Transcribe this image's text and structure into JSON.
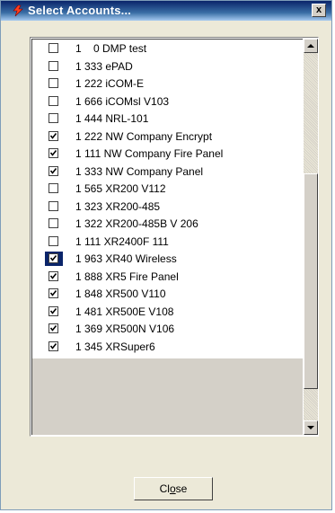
{
  "window": {
    "title": "Select Accounts...",
    "close_glyph": "x"
  },
  "accounts": [
    {
      "label": "1    0 DMP test",
      "checked": false
    },
    {
      "label": "1 333 ePAD",
      "checked": false
    },
    {
      "label": "1 222 iCOM-E",
      "checked": false
    },
    {
      "label": "1 666 iCOMsl V103",
      "checked": false
    },
    {
      "label": "1 444 NRL-101",
      "checked": false
    },
    {
      "label": "1 222 NW Company Encrypt",
      "checked": true
    },
    {
      "label": "1 111 NW Company Fire Panel",
      "checked": true
    },
    {
      "label": "1 333 NW Company Panel",
      "checked": true
    },
    {
      "label": "1 565 XR200 V112",
      "checked": false
    },
    {
      "label": "1 323 XR200-485",
      "checked": false
    },
    {
      "label": "1 322 XR200-485B V 206",
      "checked": false
    },
    {
      "label": "1 111 XR2400F 111",
      "checked": false
    },
    {
      "label": "1 963 XR40 Wireless",
      "checked": true
    },
    {
      "label": "1 888 XR5 Fire Panel",
      "checked": true
    },
    {
      "label": "1 848 XR500 V110",
      "checked": true
    },
    {
      "label": "1 481 XR500E V108",
      "checked": true
    },
    {
      "label": "1 369 XR500N V106",
      "checked": true
    },
    {
      "label": "1 345 XRSuper6",
      "checked": true
    }
  ],
  "focused_index": 12,
  "buttons": {
    "close_prefix": "Cl",
    "close_mnemonic": "o",
    "close_suffix": "se"
  },
  "colors": {
    "title_gradient_start": "#0a246a",
    "focus": "#0a246a"
  }
}
